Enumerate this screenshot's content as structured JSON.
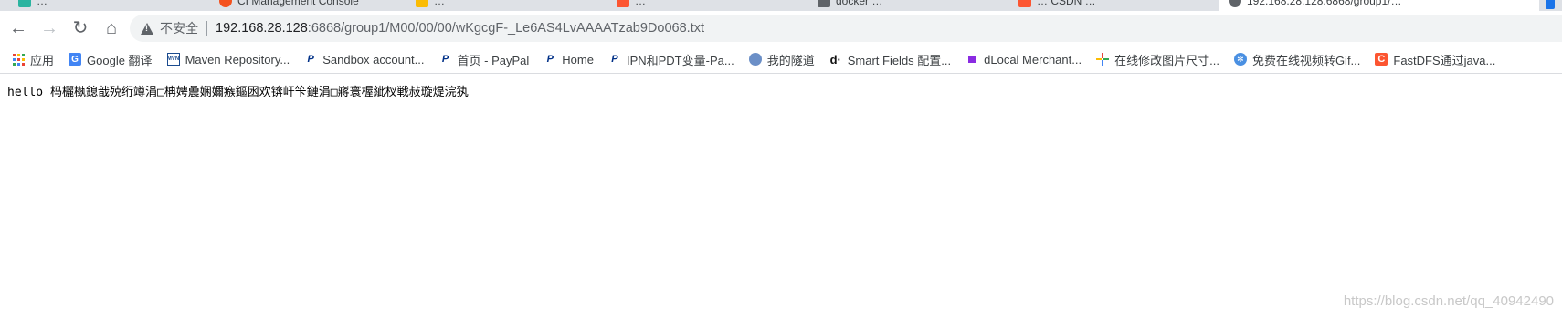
{
  "tabs": [
    {
      "title": "…",
      "favicon_color": "#2bb4a0"
    },
    {
      "title": "CI Management Console",
      "favicon_color": "#f4511e"
    },
    {
      "title": "…",
      "favicon_color": "#fbbc04"
    },
    {
      "title": "…",
      "favicon_color": "#fc5531"
    },
    {
      "title": "docker …",
      "favicon_color": "#5f6368"
    },
    {
      "title": "… CSDN …",
      "favicon_color": "#fc5531"
    },
    {
      "title": "192.168.28.128:6868/group1/…",
      "favicon_color": "#5f6368",
      "active": true
    }
  ],
  "toolbar": {
    "back_icon": "←",
    "forward_icon": "→",
    "reload_icon": "↻",
    "home_icon": "⌂"
  },
  "omnibox": {
    "security_label": "不安全",
    "url_host": "192.168.28.128",
    "url_rest": ":6868/group1/M00/00/00/wKgcgF-_Le6AS4LvAAAATzab9Do068.txt"
  },
  "bookmarks": [
    {
      "label": "应用",
      "icon": "apps-grid-icon"
    },
    {
      "label": "Google 翻译",
      "icon": "google-translate-icon",
      "color": "#4285f4"
    },
    {
      "label": "Maven Repository...",
      "icon": "maven-icon",
      "color": "#1b4b8f"
    },
    {
      "label": "Sandbox account...",
      "icon": "paypal-icon",
      "color": "#003087"
    },
    {
      "label": "首页 - PayPal",
      "icon": "paypal-icon",
      "color": "#003087"
    },
    {
      "label": "Home",
      "icon": "paypal-icon",
      "color": "#003087"
    },
    {
      "label": "IPN和PDT变量-Pa...",
      "icon": "paypal-icon",
      "color": "#003087"
    },
    {
      "label": "我的隧道",
      "icon": "globe-icon",
      "color": "#6b8fc7"
    },
    {
      "label": "Smart Fields 配置...",
      "icon": "dlocal-icon",
      "color": "#111111"
    },
    {
      "label": "dLocal Merchant...",
      "icon": "dlocal-square-icon",
      "color": "#8a2be2"
    },
    {
      "label": "在线修改图片尺寸...",
      "icon": "pinwheel-icon",
      "color": "#e8453c"
    },
    {
      "label": "免费在线视频转Gif...",
      "icon": "fan-icon",
      "color": "#4a90e2"
    },
    {
      "label": "FastDFS通过java...",
      "icon": "csdn-icon",
      "color": "#fc5531"
    }
  ],
  "page": {
    "text": "hello 杩欐槸鎴戠殑绗竴涓□柟娉曟娴嬭瘯鏂囦欢锛屽笇鏈涓□嶈寰楃紪杈戦敊璇煶浣犱"
  },
  "watermark": "https://blog.csdn.net/qq_40942490"
}
